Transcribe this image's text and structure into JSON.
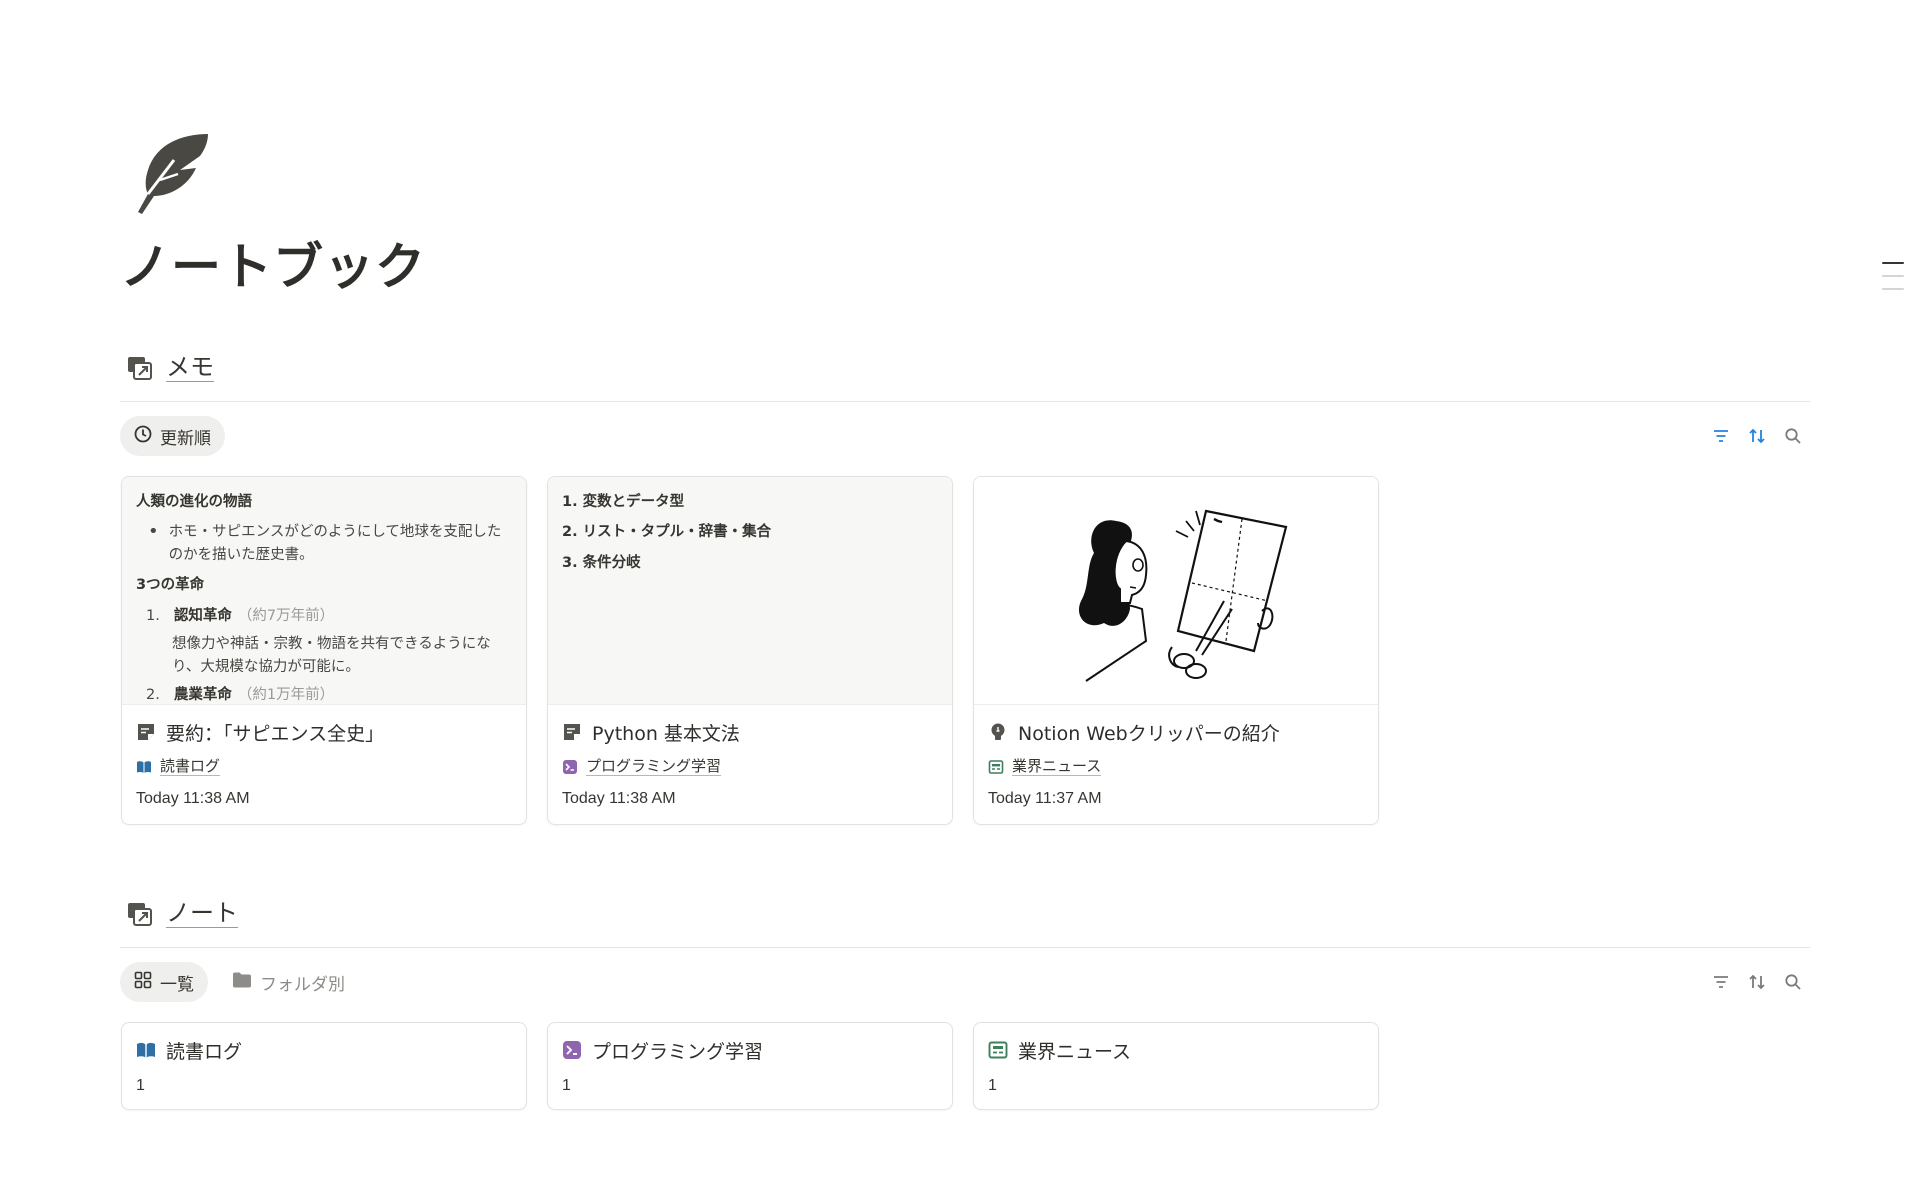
{
  "page": {
    "title": "ノートブック",
    "icon": "feather-icon"
  },
  "memo_db": {
    "title": "メモ",
    "icon": "linked-database-icon",
    "view_label": "更新順",
    "view_icon": "clock-icon",
    "tools": [
      "filter-icon",
      "sort-icon",
      "search-icon"
    ],
    "cards": [
      {
        "title": "要約：「サピエンス全史」",
        "icon": "note-icon",
        "relation": "読書ログ",
        "relation_icon": "book-icon",
        "date": "Today 11:38 AM",
        "preview": {
          "heading": "人類の進化の物語",
          "bullet": "ホモ・サピエンスがどのようにして地球を支配したのかを描いた歴史書。",
          "subheading": "3つの革命",
          "item1_num": "1.",
          "item1_title": "認知革命",
          "item1_note": "（約7万年前）",
          "item1_desc": "想像力や神話・宗教・物語を共有できるようになり、大規模な協力が可能に。",
          "item2_num": "2.",
          "item2_title": "農業革命",
          "item2_note": "（約1万年前）"
        }
      },
      {
        "title": "Python 基本文法",
        "icon": "note-icon",
        "relation": "プログラミング学習",
        "relation_icon": "terminal-icon",
        "date": "Today 11:38 AM",
        "preview": {
          "items": [
            "1. 変数とデータ型",
            "2. リスト・タプル・辞書・集合",
            "3. 条件分岐"
          ]
        }
      },
      {
        "title": "Notion Webクリッパーの紹介",
        "icon": "lightbulb-icon",
        "relation": "業界ニュース",
        "relation_icon": "newspaper-icon",
        "date": "Today 11:37 AM"
      }
    ]
  },
  "note_db": {
    "title": "ノート",
    "icon": "linked-database-icon",
    "views": [
      {
        "label": "一覧",
        "icon": "grid-icon",
        "active": true
      },
      {
        "label": "フォルダ別",
        "icon": "folder-icon",
        "active": false
      }
    ],
    "tools": [
      "filter-icon",
      "sort-icon",
      "search-icon"
    ],
    "cards": [
      {
        "title": "読書ログ",
        "icon": "book-icon",
        "count": "1"
      },
      {
        "title": "プログラミング学習",
        "icon": "terminal-icon",
        "count": "1"
      },
      {
        "title": "業界ニュース",
        "icon": "newspaper-icon",
        "count": "1"
      }
    ]
  },
  "colors": {
    "text": "#37352f",
    "book_blue": "#2f6fa8",
    "terminal_purple": "#9065b0",
    "news_green": "#3f7f5e",
    "tool_blue": "#2383e2"
  }
}
